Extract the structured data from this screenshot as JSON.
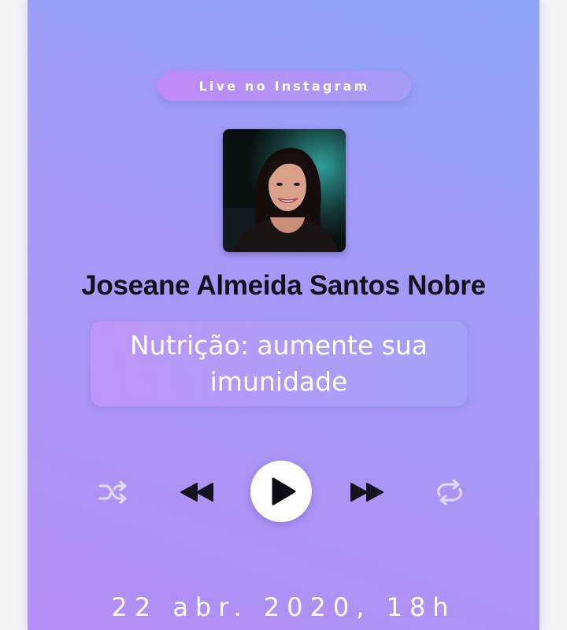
{
  "header": {
    "pill_label": "Live no Instagram"
  },
  "profile": {
    "name": "Joseane Almeida Santos Nobre"
  },
  "topic": {
    "title": "Nutrição: aumente sua imunidade"
  },
  "controls": {
    "shuffle_icon": "shuffle-icon",
    "rewind_icon": "rewind-icon",
    "play_icon": "play-icon",
    "forward_icon": "fast-forward-icon",
    "repeat_icon": "repeat-icon"
  },
  "event": {
    "date": "22 abr. 2020, 18h"
  },
  "colors": {
    "gradient_top": "#8fa4f7",
    "gradient_bottom": "#b38ef6",
    "name_text": "#14101c",
    "control_dark": "#15121c",
    "control_light": "#dcd8ff"
  }
}
